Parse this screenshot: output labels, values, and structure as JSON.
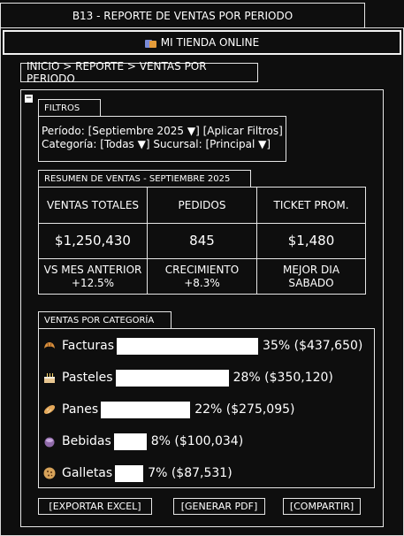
{
  "window_title": "B13 - REPORTE DE VENTAS POR PERIODO",
  "store": {
    "name": "MI TIENDA ONLINE",
    "icon": "shopping-bags-icon"
  },
  "breadcrumb": "INICIO > REPORTE > VENTAS POR PERIODO",
  "collapse_symbol": "−",
  "filters": {
    "title": "FILTROS",
    "line1": "Período: [Septiembre 2025 ▼] [Aplicar Filtros]",
    "line2": "Categoría: [Todas ▼] Sucursal: [Principal ▼]"
  },
  "summary": {
    "title": "RESUMEN DE VENTAS - SEPTIEMBRE 2025",
    "headers": [
      "VENTAS TOTALES",
      "PEDIDOS",
      "TICKET PROM."
    ],
    "values": [
      "$1,250,430",
      "845",
      "$1,480"
    ],
    "footer": [
      {
        "label": "VS MES ANTERIOR",
        "value": "+12.5%"
      },
      {
        "label": "CRECIMIENTO",
        "value": "+8.3%"
      },
      {
        "label": "MEJOR DIA",
        "value": "SABADO"
      }
    ]
  },
  "categories": {
    "title": "VENTAS POR CATEGORÍA",
    "items": [
      {
        "name": "Facturas",
        "icon": "croissant-icon",
        "percent": 35,
        "label": "35% ($437,650)"
      },
      {
        "name": "Pasteles",
        "icon": "cake-icon",
        "percent": 28,
        "label": "28% ($350,120)"
      },
      {
        "name": "Panes",
        "icon": "bread-icon",
        "percent": 22,
        "label": "22% ($275,095)"
      },
      {
        "name": "Bebidas",
        "icon": "beverage-icon",
        "percent": 8,
        "label": "8% ($100,034)"
      },
      {
        "name": "Galletas",
        "icon": "cookie-icon",
        "percent": 7,
        "label": "7% ($87,531)"
      }
    ]
  },
  "actions": {
    "export_excel": "[EXPORTAR EXCEL]",
    "generate_pdf": "[GENERAR PDF]",
    "share": "[COMPARTIR]"
  }
}
